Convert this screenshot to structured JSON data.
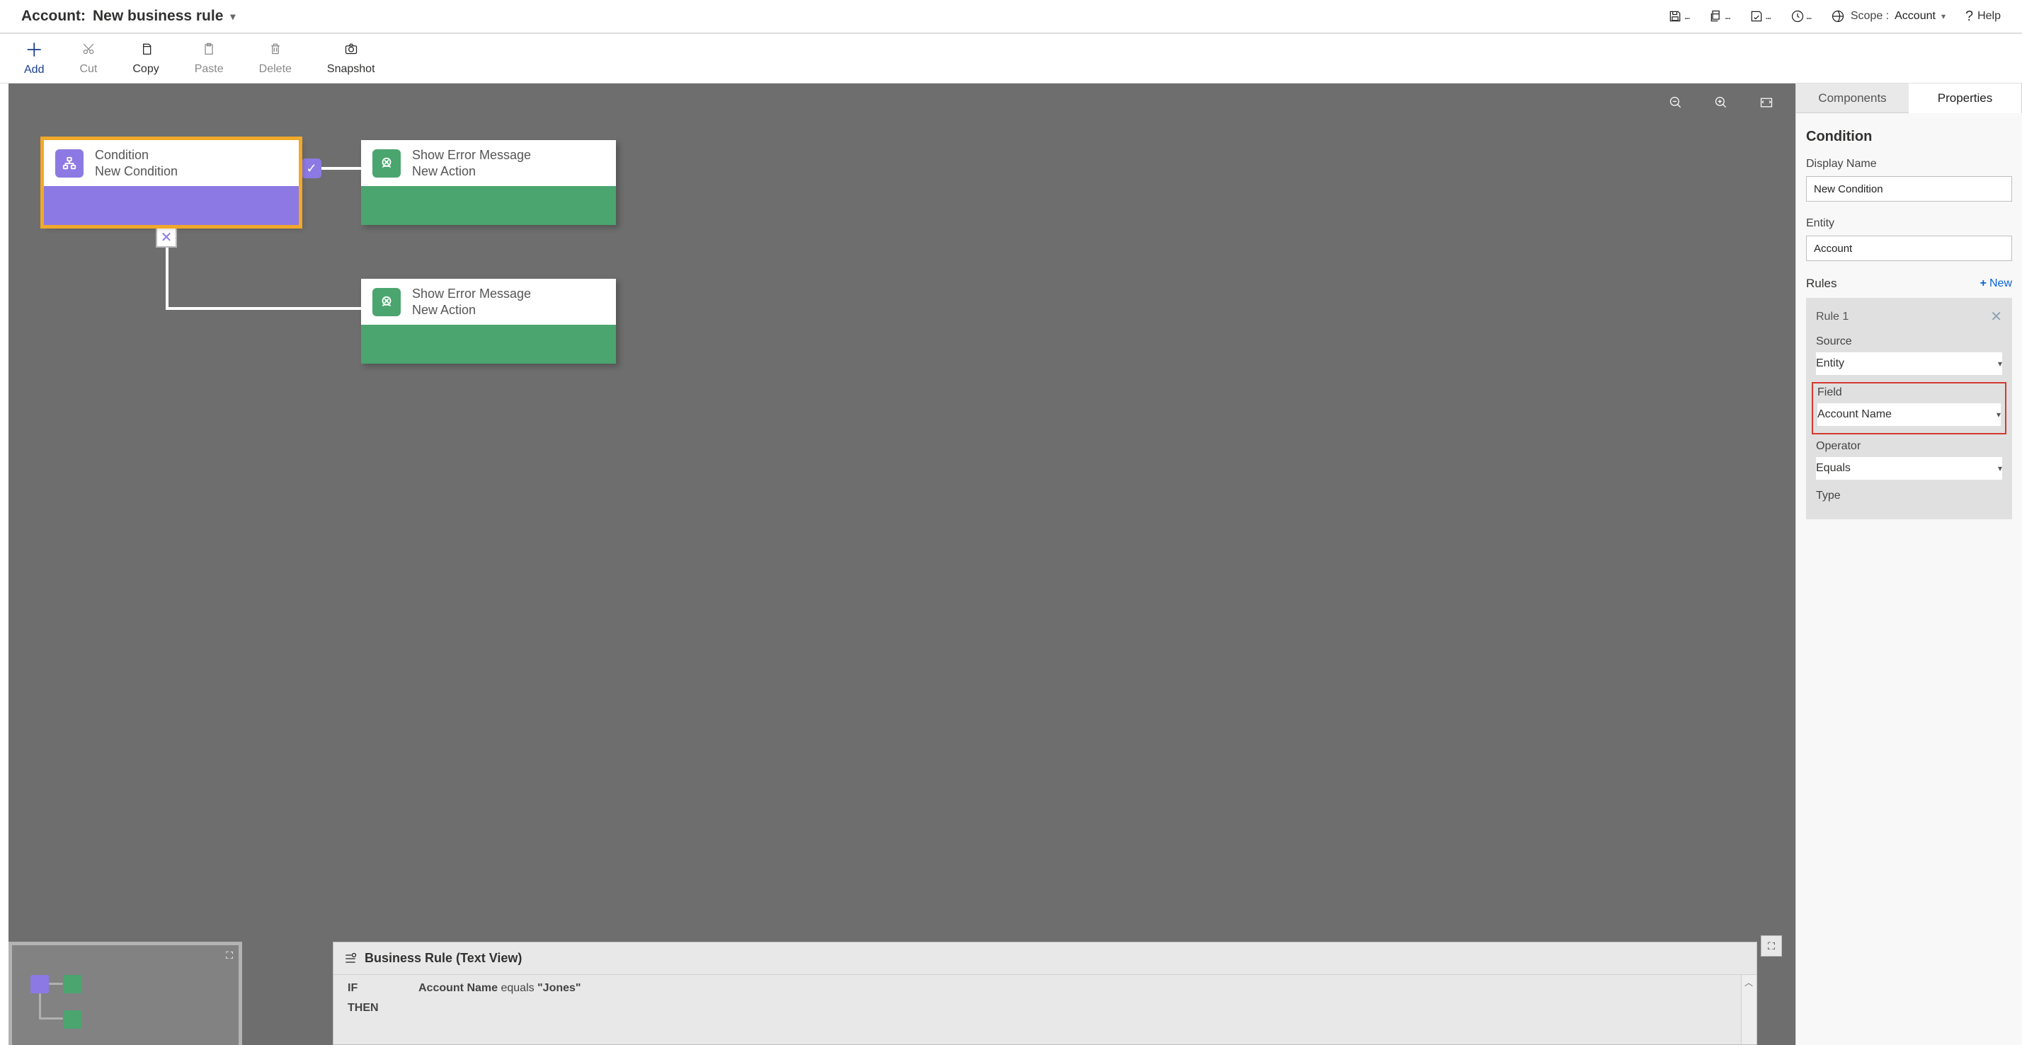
{
  "header": {
    "entity_label": "Account:",
    "rule_name": "New business rule",
    "scope_label": "Scope :",
    "scope_value": "Account",
    "help_label": "Help"
  },
  "toolbar": {
    "add": "Add",
    "cut": "Cut",
    "copy": "Copy",
    "paste": "Paste",
    "delete": "Delete",
    "snapshot": "Snapshot"
  },
  "canvas": {
    "condition": {
      "title": "Condition",
      "subtitle": "New Condition"
    },
    "action1": {
      "title": "Show Error Message",
      "subtitle": "New Action"
    },
    "action2": {
      "title": "Show Error Message",
      "subtitle": "New Action"
    }
  },
  "textview": {
    "title": "Business Rule (Text View)",
    "if_kw": "IF",
    "then_kw": "THEN",
    "expr_field": "Account Name",
    "expr_op": "equals",
    "expr_val": "\"Jones\""
  },
  "side": {
    "tab_components": "Components",
    "tab_properties": "Properties",
    "section_title": "Condition",
    "display_name_label": "Display Name",
    "display_name_value": "New Condition",
    "entity_label": "Entity",
    "entity_value": "Account",
    "rules_label": "Rules",
    "new_label": "New",
    "rule_title": "Rule 1",
    "source_label": "Source",
    "source_value": "Entity",
    "field_label": "Field",
    "field_value": "Account Name",
    "operator_label": "Operator",
    "operator_value": "Equals",
    "type_label": "Type"
  }
}
